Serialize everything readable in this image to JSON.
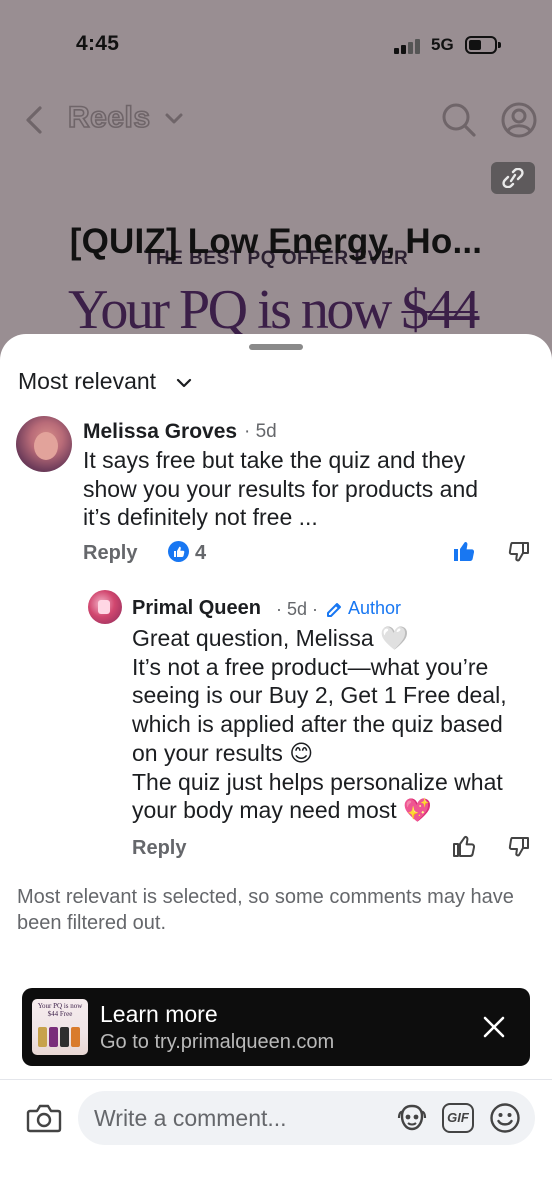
{
  "status_bar": {
    "time": "4:45",
    "network": "5G"
  },
  "nav": {
    "title": "Reels"
  },
  "ad_background": {
    "headline": "[QUIZ] Low Energy, Ho...",
    "offer_text": "THE BEST PQ OFFER EVER",
    "price_prefix": "Your PQ is now ",
    "price": "$44"
  },
  "comments": {
    "sort_label": "Most relevant",
    "items": [
      {
        "name": "Melissa Groves",
        "meta": "· 5d",
        "lines": [
          "It says free but take the quiz and they",
          "show you your results for products and",
          "it’s definitely not free ..."
        ],
        "reply_label": "Reply",
        "like_count": "4"
      },
      {
        "name": "Primal Queen",
        "meta": "· 5d ·",
        "badge": "Author",
        "lines": [
          "Great question, Melissa 🤍",
          "It’s not a free product—what you’re",
          "seeing is our Buy 2, Get 1 Free deal,",
          "which is applied after the quiz based",
          "on your results 😊",
          "The quiz just helps personalize what",
          "your body may need most 💖"
        ],
        "reply_label": "Reply"
      }
    ],
    "filter_note": "Most relevant is selected, so some comments may have been filtered out."
  },
  "ad_banner": {
    "title": "Learn more",
    "subtitle": "Go to try.primalqueen.com",
    "thumb_text": "Your PQ is now $44 Free"
  },
  "composer": {
    "placeholder": "Write a comment..."
  },
  "colors": {
    "accent": "#1877f2",
    "sheet": "#ffffff",
    "banner": "#0d0d0d",
    "backdrop": "#998e92"
  }
}
